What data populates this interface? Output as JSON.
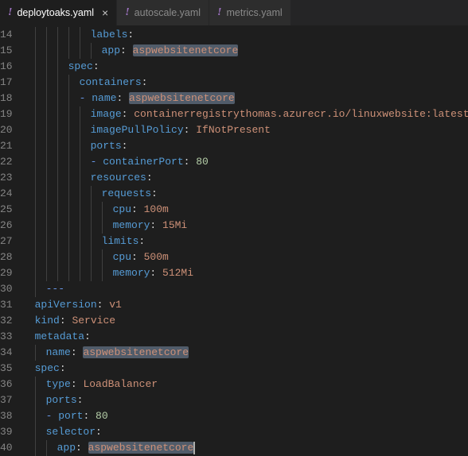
{
  "tabs": [
    {
      "label": "deploytoaks.yaml",
      "active": true,
      "dirty": false
    },
    {
      "label": "autoscale.yaml",
      "active": false,
      "dirty": false
    },
    {
      "label": "metrics.yaml",
      "active": false,
      "dirty": false
    }
  ],
  "gutter": {
    "start": 14,
    "end": 40
  },
  "highlight_token": "aspwebsitenetcore",
  "lines": {
    "14": {
      "indent": 6,
      "segments": [
        {
          "t": "labels",
          "cls": "k"
        },
        {
          "t": ":",
          "cls": "c"
        }
      ]
    },
    "15": {
      "indent": 7,
      "segments": [
        {
          "t": "app",
          "cls": "k"
        },
        {
          "t": ": ",
          "cls": "c"
        },
        {
          "t": "aspwebsitenetcore",
          "cls": "s",
          "hl": true
        }
      ]
    },
    "16": {
      "indent": 4,
      "segments": [
        {
          "t": "spec",
          "cls": "k"
        },
        {
          "t": ":",
          "cls": "c"
        }
      ]
    },
    "17": {
      "indent": 5,
      "segments": [
        {
          "t": "containers",
          "cls": "k"
        },
        {
          "t": ":",
          "cls": "c"
        }
      ]
    },
    "18": {
      "indent": 5,
      "segments": [
        {
          "t": "- ",
          "cls": "d"
        },
        {
          "t": "name",
          "cls": "k"
        },
        {
          "t": ": ",
          "cls": "c"
        },
        {
          "t": "aspwebsitenetcore",
          "cls": "s",
          "hl": true
        }
      ]
    },
    "19": {
      "indent": 6,
      "segments": [
        {
          "t": "image",
          "cls": "k"
        },
        {
          "t": ": ",
          "cls": "c"
        },
        {
          "t": "containerregistrythomas.azurecr.io/linuxwebsite:latest",
          "cls": "s"
        }
      ]
    },
    "20": {
      "indent": 6,
      "segments": [
        {
          "t": "imagePullPolicy",
          "cls": "k"
        },
        {
          "t": ": ",
          "cls": "c"
        },
        {
          "t": "IfNotPresent",
          "cls": "s"
        }
      ]
    },
    "21": {
      "indent": 6,
      "segments": [
        {
          "t": "ports",
          "cls": "k"
        },
        {
          "t": ":",
          "cls": "c"
        }
      ]
    },
    "22": {
      "indent": 6,
      "segments": [
        {
          "t": "- ",
          "cls": "d"
        },
        {
          "t": "containerPort",
          "cls": "k"
        },
        {
          "t": ": ",
          "cls": "c"
        },
        {
          "t": "80",
          "cls": "n"
        }
      ]
    },
    "23": {
      "indent": 6,
      "segments": [
        {
          "t": "resources",
          "cls": "k"
        },
        {
          "t": ":",
          "cls": "c"
        }
      ]
    },
    "24": {
      "indent": 7,
      "segments": [
        {
          "t": "requests",
          "cls": "k"
        },
        {
          "t": ":",
          "cls": "c"
        }
      ]
    },
    "25": {
      "indent": 8,
      "segments": [
        {
          "t": "cpu",
          "cls": "k"
        },
        {
          "t": ": ",
          "cls": "c"
        },
        {
          "t": "100m",
          "cls": "s"
        }
      ]
    },
    "26": {
      "indent": 8,
      "segments": [
        {
          "t": "memory",
          "cls": "k"
        },
        {
          "t": ": ",
          "cls": "c"
        },
        {
          "t": "15Mi",
          "cls": "s"
        }
      ]
    },
    "27": {
      "indent": 7,
      "segments": [
        {
          "t": "limits",
          "cls": "k"
        },
        {
          "t": ":",
          "cls": "c"
        }
      ]
    },
    "28": {
      "indent": 8,
      "segments": [
        {
          "t": "cpu",
          "cls": "k"
        },
        {
          "t": ": ",
          "cls": "c"
        },
        {
          "t": "500m",
          "cls": "s"
        }
      ]
    },
    "29": {
      "indent": 8,
      "segments": [
        {
          "t": "memory",
          "cls": "k"
        },
        {
          "t": ": ",
          "cls": "c"
        },
        {
          "t": "512Mi",
          "cls": "s"
        }
      ]
    },
    "30": {
      "indent": 2,
      "segments": [
        {
          "t": "---",
          "cls": "d"
        }
      ]
    },
    "31": {
      "indent": 1,
      "segments": [
        {
          "t": "apiVersion",
          "cls": "k"
        },
        {
          "t": ": ",
          "cls": "c"
        },
        {
          "t": "v1",
          "cls": "s"
        }
      ]
    },
    "32": {
      "indent": 1,
      "segments": [
        {
          "t": "kind",
          "cls": "k"
        },
        {
          "t": ": ",
          "cls": "c"
        },
        {
          "t": "Service",
          "cls": "s"
        }
      ]
    },
    "33": {
      "indent": 1,
      "segments": [
        {
          "t": "metadata",
          "cls": "k"
        },
        {
          "t": ":",
          "cls": "c"
        }
      ]
    },
    "34": {
      "indent": 2,
      "segments": [
        {
          "t": "name",
          "cls": "k"
        },
        {
          "t": ": ",
          "cls": "c"
        },
        {
          "t": "aspwebsitenetcore",
          "cls": "s",
          "hl": true
        }
      ]
    },
    "35": {
      "indent": 1,
      "segments": [
        {
          "t": "spec",
          "cls": "k"
        },
        {
          "t": ":",
          "cls": "c"
        }
      ]
    },
    "36": {
      "indent": 2,
      "segments": [
        {
          "t": "type",
          "cls": "k"
        },
        {
          "t": ": ",
          "cls": "c"
        },
        {
          "t": "LoadBalancer",
          "cls": "s"
        }
      ]
    },
    "37": {
      "indent": 2,
      "segments": [
        {
          "t": "ports",
          "cls": "k"
        },
        {
          "t": ":",
          "cls": "c"
        }
      ]
    },
    "38": {
      "indent": 2,
      "segments": [
        {
          "t": "- ",
          "cls": "d"
        },
        {
          "t": "port",
          "cls": "k"
        },
        {
          "t": ": ",
          "cls": "c"
        },
        {
          "t": "80",
          "cls": "n"
        }
      ]
    },
    "39": {
      "indent": 2,
      "segments": [
        {
          "t": "selector",
          "cls": "k"
        },
        {
          "t": ":",
          "cls": "c"
        }
      ]
    },
    "40": {
      "indent": 3,
      "segments": [
        {
          "t": "app",
          "cls": "k"
        },
        {
          "t": ": ",
          "cls": "c"
        },
        {
          "t": "aspwebsitenetcore",
          "cls": "s",
          "hl": true,
          "cursor": true
        }
      ]
    }
  }
}
